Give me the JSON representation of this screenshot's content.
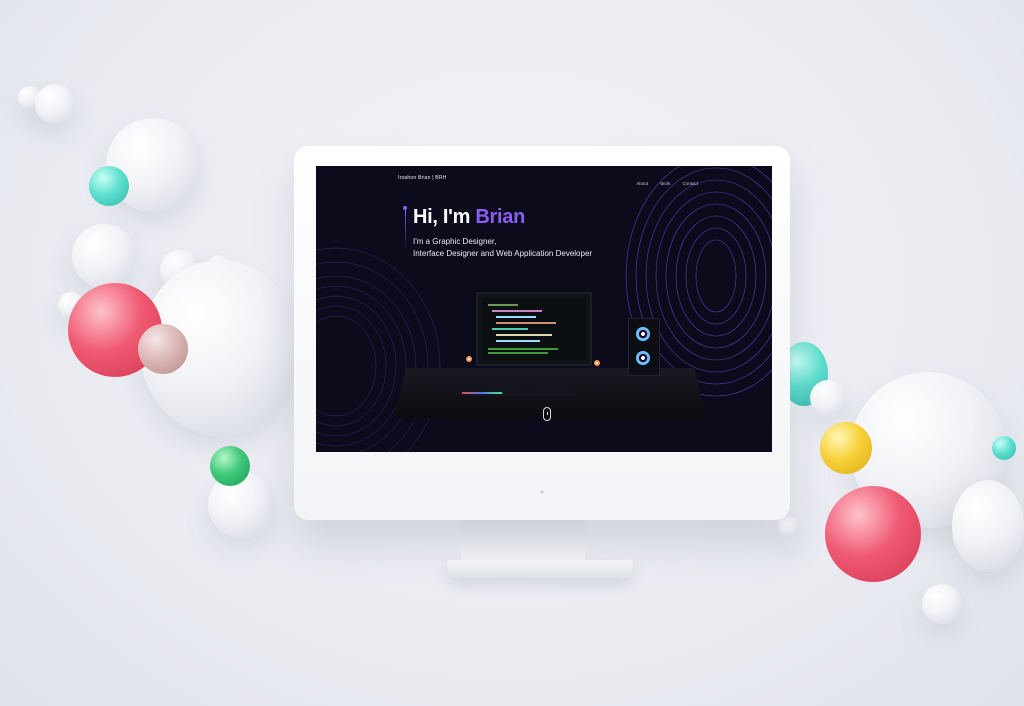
{
  "site": {
    "brand": "Iroahon Brian | BRH",
    "nav": [
      "About",
      "Work",
      "Contact"
    ],
    "hero": {
      "greeting": "Hi, I'm",
      "name": "Brian",
      "subtitle_line1": "I'm a Graphic Designer,",
      "subtitle_line2": "Interface Designer and Web Application Developer"
    },
    "scroll_icon": "mouse-scroll-icon"
  },
  "colors": {
    "accent": "#8b5cf6",
    "screen_bg": "#0b0b1c",
    "page_bg": "#eef0f4",
    "sphere_pink": "#ef5a72",
    "sphere_teal": "#5fe0cf",
    "sphere_green": "#3ec77a",
    "sphere_yellow": "#f7d23b"
  }
}
